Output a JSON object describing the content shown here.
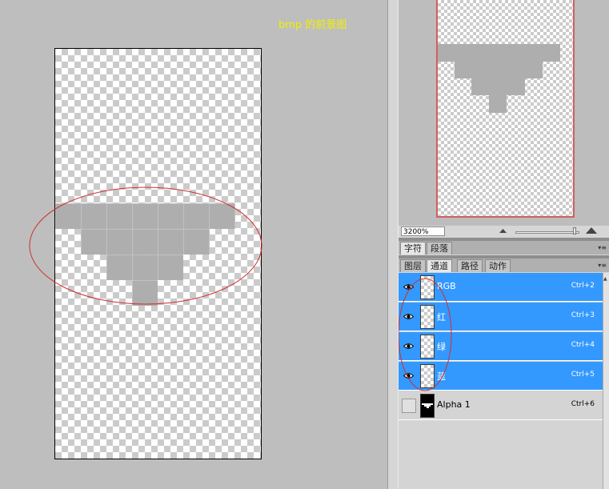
{
  "canvas": {
    "title": "bmp 的前景图",
    "colors": {
      "workspace": "#bebebe",
      "title": "#f0f000",
      "pixels": "#aeaeae",
      "annotation": "#d03030"
    }
  },
  "navigator": {
    "zoom": "3200%",
    "frame_color": "#d06060"
  },
  "char_panel": {
    "tabs": [
      {
        "label": "字符",
        "active": true
      },
      {
        "label": "段落",
        "active": false
      }
    ]
  },
  "layers_panel": {
    "tabs": [
      {
        "label": "图层",
        "active": false
      },
      {
        "label": "通道",
        "active": true
      },
      {
        "label": "路径",
        "active": false
      },
      {
        "label": "动作",
        "active": false
      }
    ],
    "selected_color": "#3399ff",
    "channels": [
      {
        "name": "RGB",
        "shortcut": "Ctrl+2",
        "selected": true,
        "visible": true
      },
      {
        "name": "红",
        "shortcut": "Ctrl+3",
        "selected": true,
        "visible": true
      },
      {
        "name": "绿",
        "shortcut": "Ctrl+4",
        "selected": true,
        "visible": true
      },
      {
        "name": "蓝",
        "shortcut": "Ctrl+5",
        "selected": true,
        "visible": true
      },
      {
        "name": "Alpha 1",
        "shortcut": "Ctrl+6",
        "selected": false,
        "visible": false
      }
    ]
  },
  "icons": [
    "eye-icon",
    "zoom-out-icon",
    "zoom-in-icon",
    "panel-menu-icon",
    "scroll-up-icon"
  ]
}
